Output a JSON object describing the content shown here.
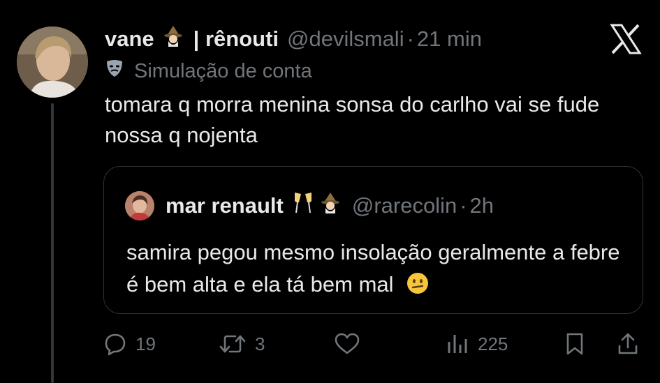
{
  "tweet": {
    "display_name": "vane",
    "separator": "| rênouti",
    "handle": "@devilsmali",
    "dot": "·",
    "time": "21 min",
    "simulation_label": "Simulação de conta",
    "text": "tomara q morra menina sonsa do carlho vai se fude nossa q nojenta"
  },
  "quote": {
    "display_name": "mar renault",
    "handle": "@rarecolin",
    "dot": "·",
    "time": "2h",
    "text": "samira pegou mesmo insolação geralmente a febre é bem alta e ela tá bem mal"
  },
  "actions": {
    "replies": "19",
    "reposts": "3",
    "views": "225"
  },
  "icons": {
    "header_emoji": "mage-emoji",
    "simulation": "theater-masks-icon",
    "quote_emojis": [
      "champagne-glasses-emoji",
      "mage-emoji"
    ],
    "quote_end_emoji": "confused-face-emoji",
    "brand": "x-logo-icon"
  },
  "colors": {
    "background": "#000000",
    "text": "#e7e9ea",
    "muted": "#71767b",
    "border": "#2f3336"
  }
}
